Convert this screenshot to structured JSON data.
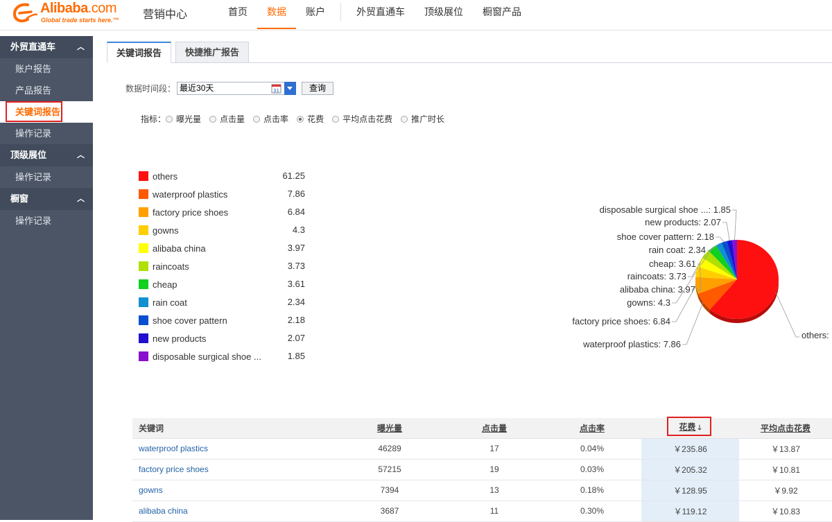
{
  "brand": {
    "logo_text": "Alibaba",
    "logo_suffix": ".com",
    "slogan": "Global trade starts here.™",
    "app_title": "营销中心"
  },
  "topnav": [
    {
      "label": "首页",
      "active": false
    },
    {
      "label": "数据",
      "active": true
    },
    {
      "label": "账户",
      "active": false
    },
    {
      "label": "外贸直通车",
      "active": false
    },
    {
      "label": "顶级展位",
      "active": false
    },
    {
      "label": "橱窗产品",
      "active": false
    }
  ],
  "sidebar": {
    "groups": [
      {
        "label": "外贸直通车",
        "items": [
          "账户报告",
          "产品报告",
          "关键词报告",
          "操作记录"
        ]
      },
      {
        "label": "顶级展位",
        "items": [
          "操作记录"
        ]
      },
      {
        "label": "橱窗",
        "items": [
          "操作记录"
        ]
      }
    ],
    "active_item": "关键词报告"
  },
  "tabs": [
    {
      "label": "关键词报告",
      "active": true
    },
    {
      "label": "快捷推广报告",
      "active": false
    }
  ],
  "filters": {
    "date_label": "数据时间段：",
    "date_value": "最近30天",
    "query_button": "查询",
    "metric_label": "指标：",
    "metrics": [
      "曝光量",
      "点击量",
      "点击率",
      "花费",
      "平均点击花费",
      "推广时长"
    ],
    "selected_metric": "花费"
  },
  "chart_data": {
    "type": "pie",
    "title": "",
    "slices": [
      {
        "name": "others",
        "value": 61.25,
        "color": "#ff1010"
      },
      {
        "name": "waterproof plastics",
        "value": 7.86,
        "color": "#ff5a00"
      },
      {
        "name": "factory price shoes",
        "value": 6.84,
        "color": "#ffa000"
      },
      {
        "name": "gowns",
        "value": 4.3,
        "color": "#ffce00"
      },
      {
        "name": "alibaba china",
        "value": 3.97,
        "color": "#ffff00"
      },
      {
        "name": "raincoats",
        "value": 3.73,
        "color": "#b0e000"
      },
      {
        "name": "cheap",
        "value": 3.61,
        "color": "#10d020"
      },
      {
        "name": "rain coat",
        "value": 2.34,
        "color": "#1090d0"
      },
      {
        "name": "shoe cover pattern",
        "value": 2.18,
        "color": "#0a4fd0"
      },
      {
        "name": "new products",
        "value": 2.07,
        "color": "#2010d0"
      },
      {
        "name": "disposable surgical shoe ...",
        "value": 1.85,
        "color": "#8a10d0"
      }
    ],
    "legend_placement": "left"
  },
  "table": {
    "columns": [
      "关键词",
      "曝光量",
      "点击量",
      "点击率",
      "花费",
      "平均点击花费"
    ],
    "sorted_column": "花费",
    "rows": [
      [
        "waterproof plastics",
        "46289",
        "17",
        "0.04%",
        "￥235.86",
        "￥13.87"
      ],
      [
        "factory price shoes",
        "57215",
        "19",
        "0.03%",
        "￥205.32",
        "￥10.81"
      ],
      [
        "gowns",
        "7394",
        "13",
        "0.18%",
        "￥128.95",
        "￥9.92"
      ],
      [
        "alibaba china",
        "3687",
        "11",
        "0.30%",
        "￥119.12",
        "￥10.83"
      ]
    ]
  }
}
